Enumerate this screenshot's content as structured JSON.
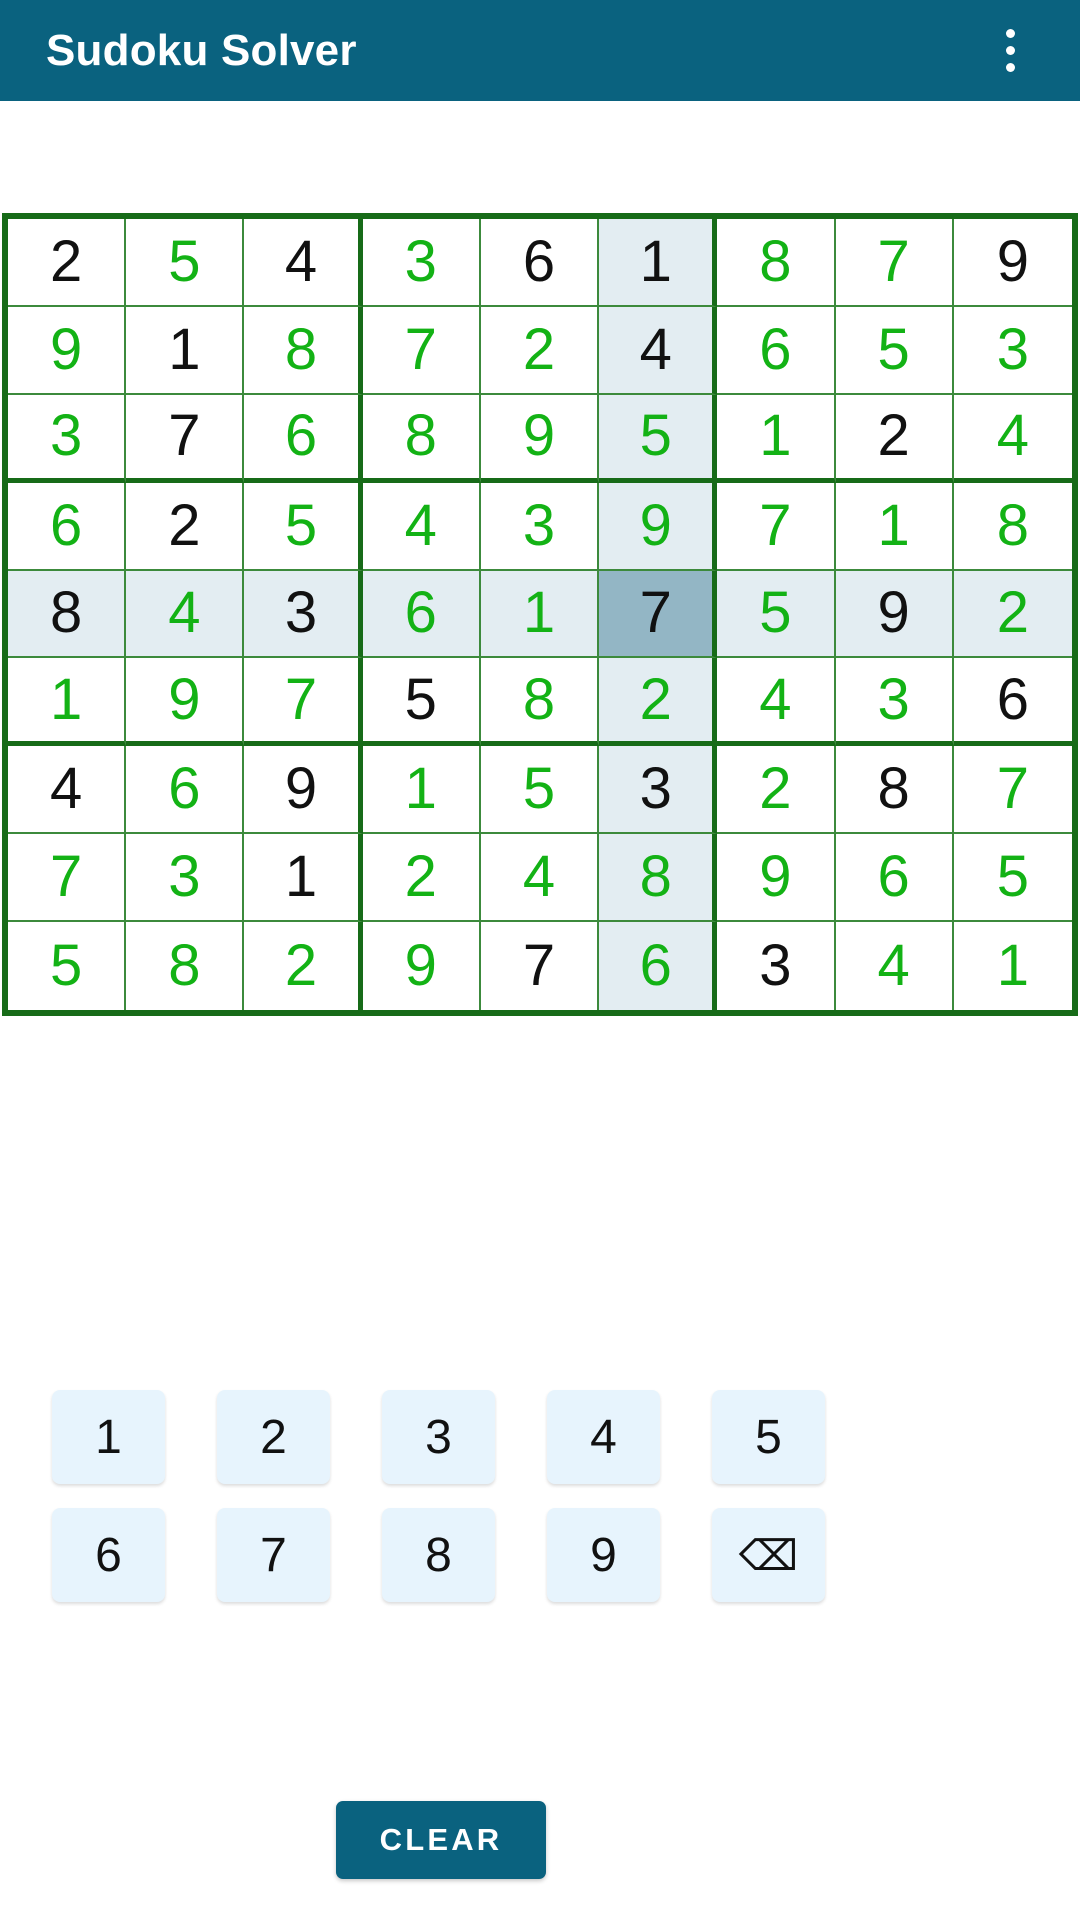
{
  "app": {
    "title": "Sudoku Solver",
    "accent_color": "#0a627f",
    "grid_border_color": "#176b18",
    "given_color": "#111111",
    "solved_color": "#13b215",
    "peer_highlight_color": "#e3edf2",
    "selected_color": "#93b6c5",
    "key_color": "#e7f4fd"
  },
  "appbar": {
    "title": "Sudoku Solver",
    "overflow_menu_label": "More options"
  },
  "board": {
    "selected_row": 4,
    "selected_col": 5,
    "rows": [
      {
        "values": [
          "2",
          "5",
          "4",
          "3",
          "6",
          "1",
          "8",
          "7",
          "9"
        ],
        "given": [
          true,
          false,
          true,
          false,
          true,
          true,
          false,
          false,
          true
        ]
      },
      {
        "values": [
          "9",
          "1",
          "8",
          "7",
          "2",
          "4",
          "6",
          "5",
          "3"
        ],
        "given": [
          false,
          true,
          false,
          false,
          false,
          true,
          false,
          false,
          false
        ]
      },
      {
        "values": [
          "3",
          "7",
          "6",
          "8",
          "9",
          "5",
          "1",
          "2",
          "4"
        ],
        "given": [
          false,
          true,
          false,
          false,
          false,
          false,
          false,
          true,
          false
        ]
      },
      {
        "values": [
          "6",
          "2",
          "5",
          "4",
          "3",
          "9",
          "7",
          "1",
          "8"
        ],
        "given": [
          false,
          true,
          false,
          false,
          false,
          false,
          false,
          false,
          false
        ]
      },
      {
        "values": [
          "8",
          "4",
          "3",
          "6",
          "1",
          "7",
          "5",
          "9",
          "2"
        ],
        "given": [
          true,
          false,
          true,
          false,
          false,
          true,
          false,
          true,
          false
        ]
      },
      {
        "values": [
          "1",
          "9",
          "7",
          "5",
          "8",
          "2",
          "4",
          "3",
          "6"
        ],
        "given": [
          false,
          false,
          false,
          true,
          false,
          false,
          false,
          false,
          true
        ]
      },
      {
        "values": [
          "4",
          "6",
          "9",
          "1",
          "5",
          "3",
          "2",
          "8",
          "7"
        ],
        "given": [
          true,
          false,
          true,
          false,
          false,
          true,
          false,
          true,
          false
        ]
      },
      {
        "values": [
          "7",
          "3",
          "1",
          "2",
          "4",
          "8",
          "9",
          "6",
          "5"
        ],
        "given": [
          false,
          false,
          true,
          false,
          false,
          false,
          false,
          false,
          false
        ]
      },
      {
        "values": [
          "5",
          "8",
          "2",
          "9",
          "7",
          "6",
          "3",
          "4",
          "1"
        ],
        "given": [
          false,
          false,
          false,
          false,
          true,
          false,
          true,
          false,
          false
        ]
      }
    ]
  },
  "numpad": {
    "rows": [
      [
        "1",
        "2",
        "3",
        "4",
        "5"
      ],
      [
        "6",
        "7",
        "8",
        "9",
        "⌫"
      ]
    ],
    "backspace_label": "⌫",
    "backspace_name": "backspace-icon"
  },
  "actions": {
    "clear_label": "CLEAR"
  }
}
